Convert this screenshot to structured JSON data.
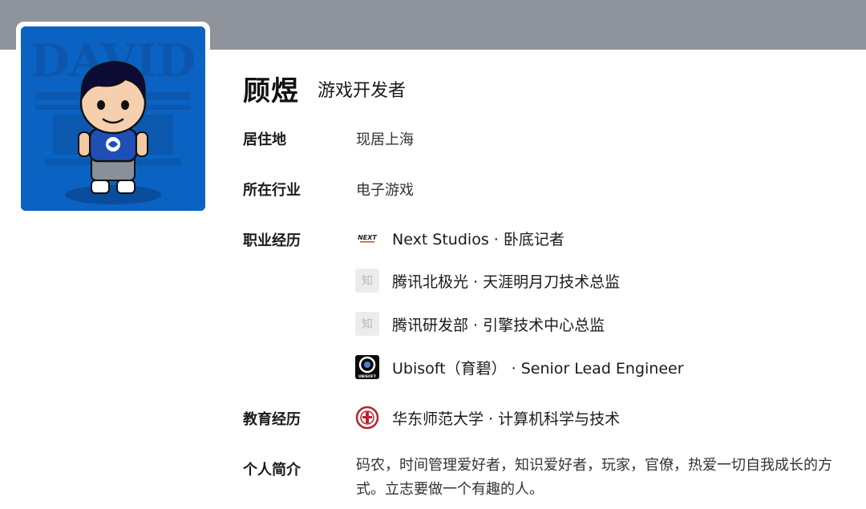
{
  "profile": {
    "avatar_text": "DAVID",
    "name": "顾煜",
    "headline": "游戏开发者"
  },
  "info": {
    "residence_label": "居住地",
    "residence_value": "现居上海",
    "industry_label": "所在行业",
    "industry_value": "电子游戏",
    "career_label": "职业经历",
    "education_label": "教育经历",
    "bio_label": "个人简介"
  },
  "career": [
    {
      "logo": "next-studios-logo",
      "logo_text": "NEXT",
      "text": "Next Studios · 卧底记者"
    },
    {
      "logo": "zhihu-placeholder-logo",
      "logo_text": "知",
      "text": "腾讯北极光 · 天涯明月刀技术总监"
    },
    {
      "logo": "zhihu-placeholder-logo",
      "logo_text": "知",
      "text": "腾讯研发部 · 引擎技术中心总监"
    },
    {
      "logo": "ubisoft-logo",
      "logo_text": "UBISOFT",
      "text": "Ubisoft（育碧） · Senior Lead Engineer"
    }
  ],
  "education": [
    {
      "logo": "ecnu-logo",
      "text": "华东师范大学 · 计算机科学与技术"
    }
  ],
  "bio": "码农，时间管理爱好者，知识爱好者，玩家，官僚，热爱一切自我成长的方式。立志要做一个有趣的人。",
  "colors": {
    "cover": "#8f949c",
    "avatar_bg": "#0a63c2",
    "avatar_dark": "#094d9c",
    "ecnu_red": "#b3262e"
  }
}
